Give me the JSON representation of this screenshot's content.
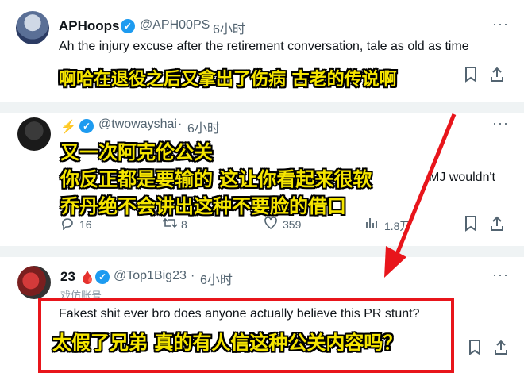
{
  "tweet1": {
    "name": "APHoops",
    "handle": "@APH00PS",
    "time": "6小时",
    "text": "Ah the injury excuse after the retirement conversation, tale as old as time",
    "caption": "啊哈在退役之后又拿出了伤病 古老的传说啊"
  },
  "tweet2": {
    "handle": "@twowayshai",
    "time": "6小时",
    "text_fragment": "MJ wouldn't",
    "caption_lines": [
      "又一次阿克伦公关",
      "你反正都是要输的 这让你看起来很软",
      "乔丹绝不会讲出这种不要脸的借口"
    ],
    "replies": "16",
    "retweets": "8",
    "likes": "359",
    "views": "1.8万"
  },
  "tweet3": {
    "name": "23",
    "handle": "@Top1Big23",
    "time": "6小时",
    "sub_label": "戏仿账号",
    "text": "Fakest shit ever bro does anyone actually believe this PR stunt?",
    "caption": "太假了兄弟 真的有人信这种公关内容吗？"
  },
  "icons": {
    "verified": "verified-badge-icon",
    "more": "more-icon",
    "bookmark": "bookmark-icon",
    "share": "share-icon",
    "reply": "reply-icon",
    "retweet": "retweet-icon",
    "like": "like-icon",
    "views": "views-icon"
  },
  "colors": {
    "accent": "#1d9bf0",
    "caption": "#f5e500",
    "highlight_box": "#e8151b"
  }
}
